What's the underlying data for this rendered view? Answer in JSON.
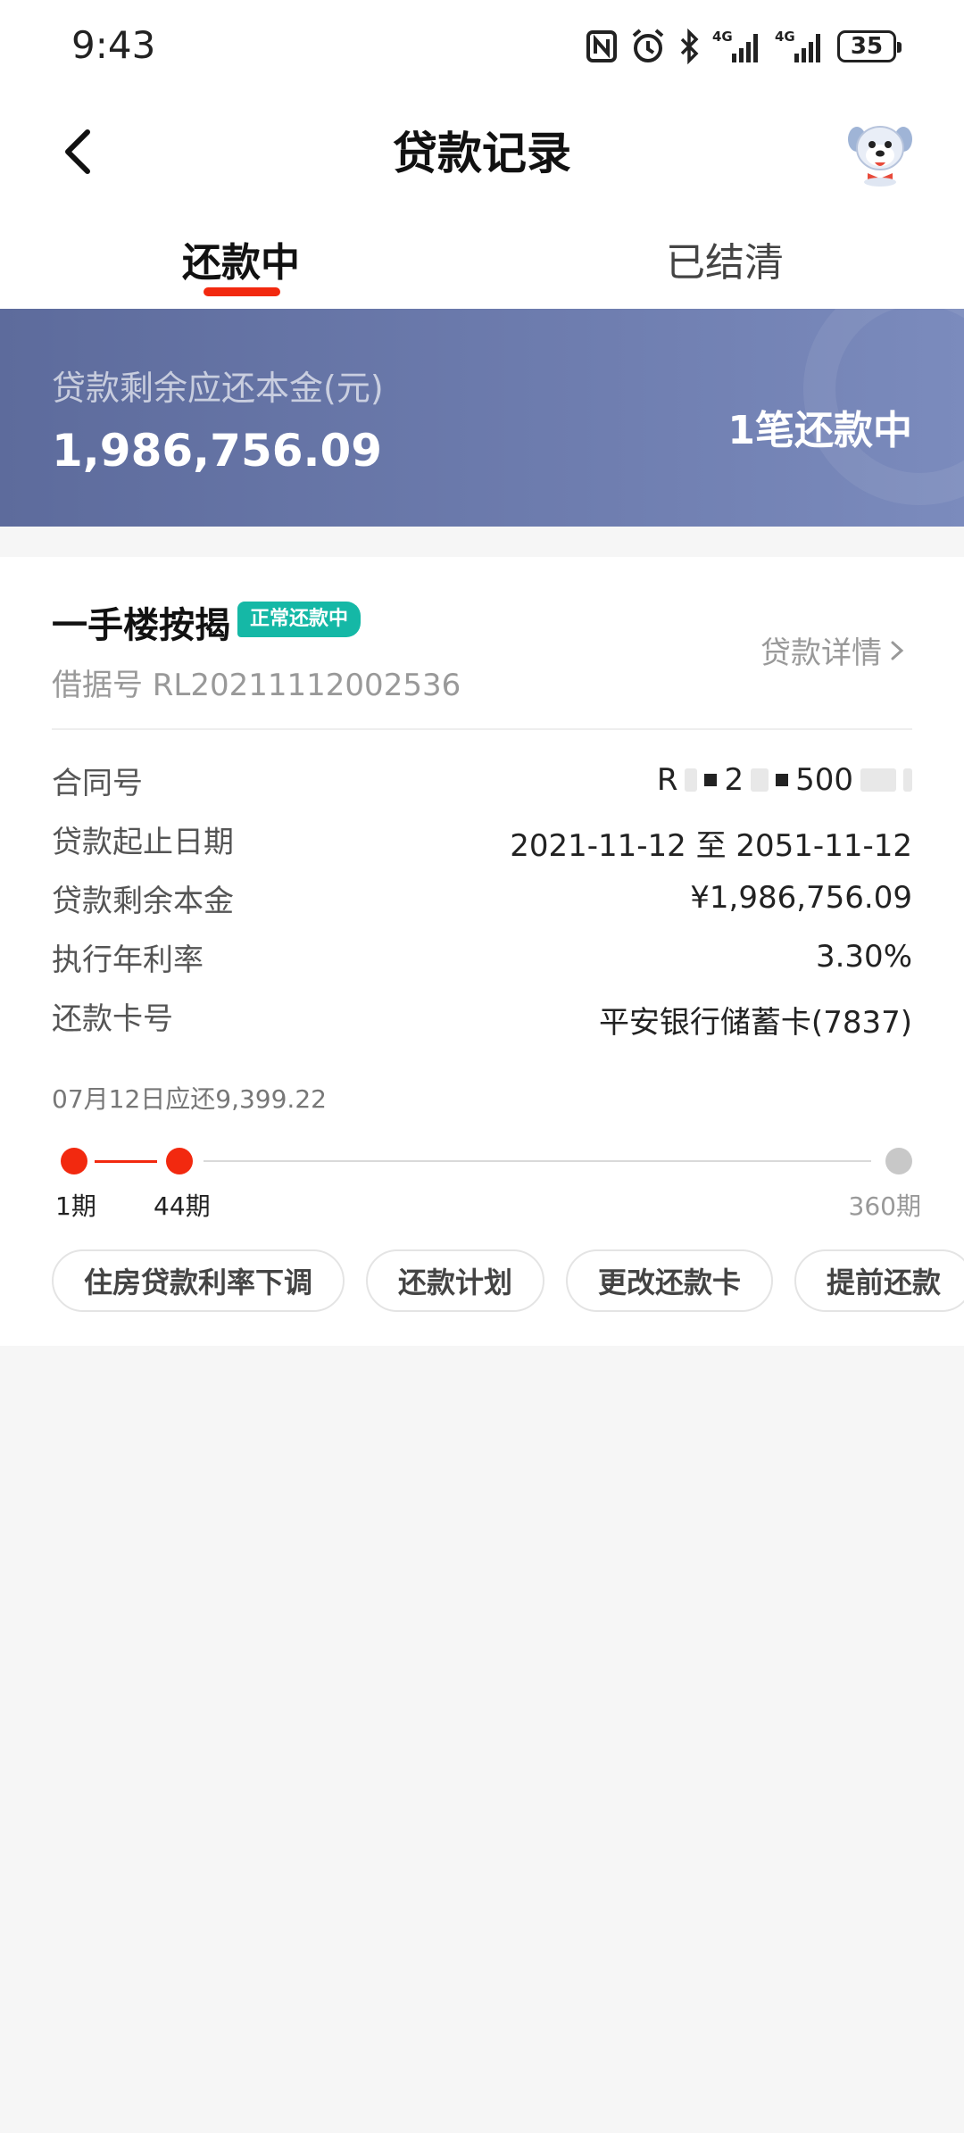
{
  "status_bar": {
    "time": "9:43",
    "battery": "35",
    "icons": [
      "nfc-icon",
      "alarm-icon",
      "bluetooth-icon",
      "signal-4g-icon",
      "signal-4g-icon"
    ]
  },
  "header": {
    "title": "贷款记录",
    "back_icon": "chevron-left-icon",
    "mascot_icon": "mascot-avatar-icon"
  },
  "tabs": [
    {
      "label": "还款中",
      "active": true
    },
    {
      "label": "已结清",
      "active": false
    }
  ],
  "banner": {
    "label": "贷款剩余应还本金(元)",
    "amount": "1,986,756.09",
    "count_text": "1笔还款中"
  },
  "loan": {
    "title": "一手楼按揭",
    "status_badge": "正常还款中",
    "receipt_no": "借据号 RL20211112002536",
    "detail_link": "贷款详情",
    "rows": [
      {
        "label": "合同号",
        "value_parts": [
          "R",
          "2",
          "500"
        ]
      },
      {
        "label": "贷款起止日期",
        "value": "2021-11-12 至 2051-11-12"
      },
      {
        "label": "贷款剩余本金",
        "value": "¥1,986,756.09"
      },
      {
        "label": "执行年利率",
        "value": "3.30%"
      },
      {
        "label": "还款卡号",
        "value": "平安银行储蓄卡(7837)"
      }
    ],
    "plan_note": "07月12日应还9,399.22",
    "progress": {
      "start_label": "1期",
      "current_label": "44期",
      "end_label": "360期",
      "current_period": 44,
      "total_periods": 360
    }
  },
  "actions": [
    "住房贷款利率下调",
    "还款计划",
    "更改还款卡",
    "提前还款"
  ],
  "colors": {
    "accent": "#f2290f",
    "banner": "#6e7daf",
    "badge": "#15b8a6"
  }
}
